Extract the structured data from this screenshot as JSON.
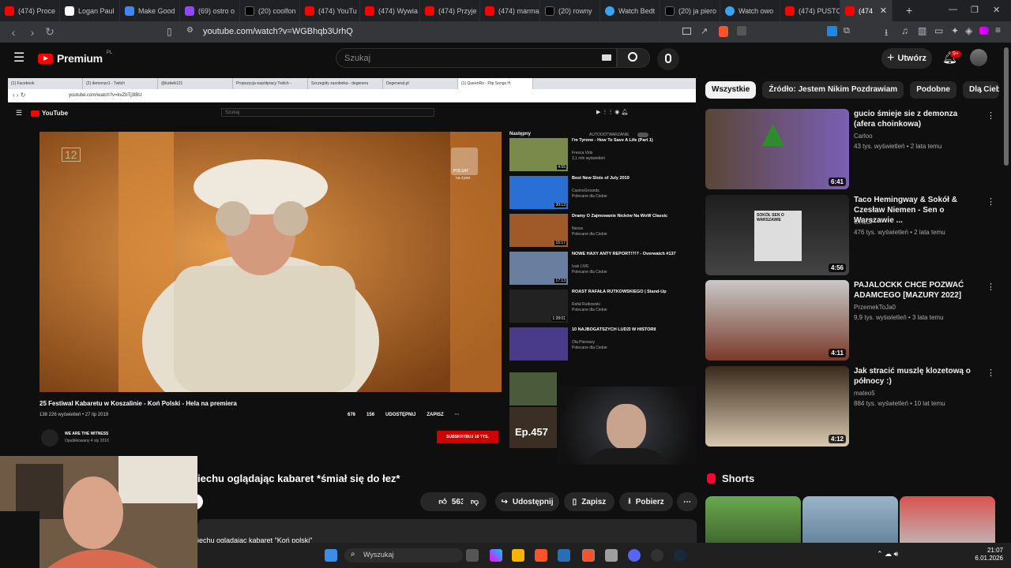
{
  "browser": {
    "tabs": [
      {
        "label": "(474) Proce",
        "icon": "youtube-icon"
      },
      {
        "label": "Logan Paul",
        "icon": "kick-icon"
      },
      {
        "label": "Make Good",
        "icon": "google-icon"
      },
      {
        "label": "(69) ostro o",
        "icon": "twitch-icon"
      },
      {
        "label": "(20) coolfon",
        "icon": "x-icon"
      },
      {
        "label": "(474) YouTu",
        "icon": "youtube-icon"
      },
      {
        "label": "(474) Wywia",
        "icon": "youtube-icon"
      },
      {
        "label": "(474) Przyje",
        "icon": "youtube-icon"
      },
      {
        "label": "(474) marma",
        "icon": "youtube-icon"
      },
      {
        "label": "(20) rowny",
        "icon": "x-icon"
      },
      {
        "label": "Watch Bedt",
        "icon": "chrome-icon"
      },
      {
        "label": "(20) ja piero",
        "icon": "x-icon"
      },
      {
        "label": "Watch owo",
        "icon": "chrome-icon"
      },
      {
        "label": "(474) PUSTC",
        "icon": "youtube-icon"
      },
      {
        "label": "(474",
        "icon": "youtube-icon",
        "active": true
      }
    ],
    "url": "youtube.com/watch?v=WGBhqb3UrhQ"
  },
  "youtube": {
    "logo_text": "Premium",
    "logo_country": "PL",
    "search_placeholder": "Szukaj",
    "create_label": "Utwórz",
    "notification_count": "9+"
  },
  "inner": {
    "tabs": [
      "(1) Facebook",
      "(2) demonzz1 - Twitch",
      "@ludwik121",
      "Propozycja współpracy Twitch -",
      "Szczegóły zasobnika - degeneru",
      "Degenerat.pl",
      "(1) QueenRo - Flip Songs H"
    ],
    "url": "youtube.com/watch?v=kvZbTj3lBU",
    "logo_text": "YouTube",
    "search_placeholder": "Szukaj",
    "video_title": "25 Festiwal Kabaretu w Koszalinie - Koń Polski - Hela na premiera",
    "video_meta": "138 226 wyświetleń • 27 lip 2019",
    "likes": "676",
    "dislikes": "156",
    "share": "UDOSTĘPNIJ",
    "save": "ZAPISZ",
    "channel": "WE ARE THE WITNESS",
    "uploaded": "Opublikowany 4 sty 2016",
    "subscribe": "SUBSKRYBUJ  10 TYS.",
    "next_label": "Następny",
    "autoplay_label": "AUTOODTWARZANIE",
    "broadcaster_badge": "POLSAT",
    "broadcaster_live": "na żywo",
    "channel_number": "12",
    "recs": [
      {
        "title": "I'm Tyrone - How To Save A Life (Part 1)",
        "channel": "Fresca Vids",
        "stats": "3,1 mln wyświetleń",
        "duration": "4:55"
      },
      {
        "title": "Best New Slots of July 2019",
        "channel": "CasinoGrounds",
        "stats": "Polecane dla Ciebie",
        "duration": "30:13"
      },
      {
        "title": "Dramy O Zajmowanie Nicków Na WoW Classic",
        "channel": "Nexos",
        "stats": "Polecane dla Ciebie",
        "duration": "15:17"
      },
      {
        "title": "NOWE HAXY ANTY REPORT!?!? - Overwatch #137",
        "channel": "Izak LIVE",
        "stats": "Polecane dla Ciebie",
        "duration": "17:13"
      },
      {
        "title": "ROAST RAFAŁA RUTKOWSKIEGO | Stand-Up",
        "channel": "Rafał Rutkowski",
        "stats": "Polecane dla Ciebie",
        "duration": "1:28:01"
      },
      {
        "title": "10 NAJBOGATSZYCH LUDZI W HISTORII",
        "channel": "Ola Pierwszy",
        "stats": "Polecane dla Ciebie",
        "duration": ""
      }
    ],
    "ep_label": "Ep.457"
  },
  "main": {
    "title_visible": "iechu oglądając kabaret *śmiał się do łez*",
    "likes": "563",
    "share_label": "Udostępnij",
    "save_label": "Zapisz",
    "download_label": "Pobierz",
    "desc_line": "iechu oglądając kabaret \"Koń polski\""
  },
  "sidebar": {
    "chips": [
      "Wszystkie",
      "Źródło: Jestem Nikim Pozdrawiam",
      "Podobne",
      "Dla Cieb"
    ],
    "videos": [
      {
        "title": "gucio śmieje sie z demonza (afera choinkowa)",
        "channel": "Carloo",
        "stats": "43 tys. wyświetleń • 2 lata temu",
        "duration": "6:41"
      },
      {
        "title": "Taco Hemingway & Sokół & Czesław Niemen - Sen o Warszawie ...",
        "channel": "ORL3F",
        "stats": "476 tys. wyświetleń • 2 lata temu",
        "duration": "4:56",
        "thumb_text": "SOKÓŁ SEN O WARSZAWIE"
      },
      {
        "title": "PAJALOCKK CHCE POZWAĆ ADAMCEGO [MAZURY 2022]",
        "channel": "PrzemekToJa0",
        "stats": "9,9 tys. wyświetleń • 3 lata temu",
        "duration": "4:11"
      },
      {
        "title": "Jak stracić muszlę klozetową o północy :)",
        "channel": "mateo5",
        "stats": "884 tys. wyświetleń • 10 lat temu",
        "duration": "4:12"
      }
    ],
    "shorts_label": "Shorts"
  },
  "taskbar": {
    "search_label": "Wyszukaj",
    "time": "21:07",
    "date": "6.01.2026"
  }
}
